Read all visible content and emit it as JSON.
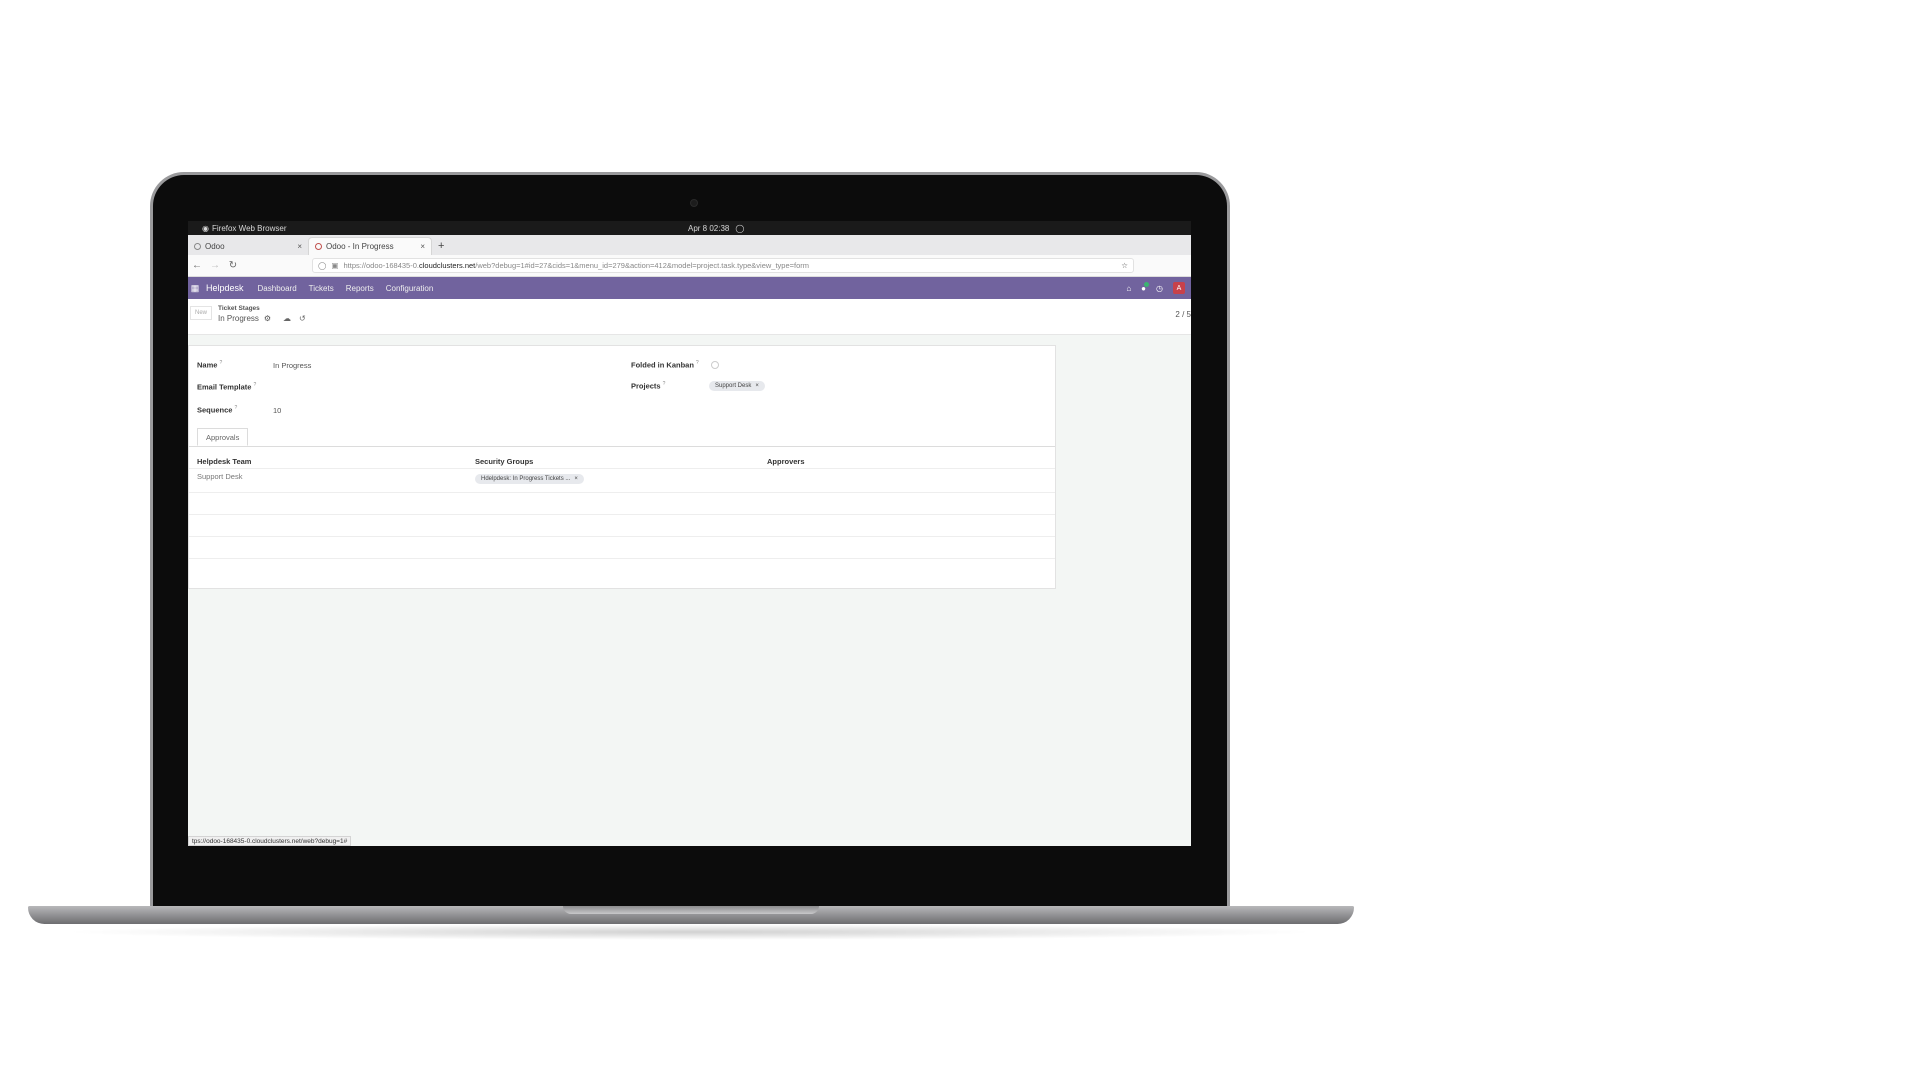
{
  "os_bar": {
    "app_name": "Firefox Web Browser",
    "clock": "Apr 8  02:38"
  },
  "browser": {
    "tabs": [
      {
        "label": "Odoo"
      },
      {
        "label": "Odoo - In Progress"
      }
    ],
    "url": {
      "prefix": "https://odoo-168435-0.",
      "host": "cloudclusters.net",
      "path": "/web?debug=1#id=27&cids=1&menu_id=279&action=412&model=project.task.type&view_type=form"
    },
    "status_url": "tps://odoo-168435-0.cloudclusters.net/web?debug=1#"
  },
  "odoo_nav": {
    "brand": "Helpdesk",
    "menu": [
      "Dashboard",
      "Tickets",
      "Reports",
      "Configuration"
    ],
    "avatar_letter": "A"
  },
  "control_panel": {
    "new_button": "New",
    "breadcrumb_parent": "Ticket Stages",
    "breadcrumb_current": "In Progress",
    "pager": "2 / 5"
  },
  "form": {
    "name_label": "Name",
    "name_value": "In Progress",
    "email_template_label": "Email Template",
    "sequence_label": "Sequence",
    "sequence_value": "10",
    "folded_label": "Folded in Kanban",
    "projects_label": "Projects",
    "projects_tag": "Support Desk",
    "tooltip_mark": "?"
  },
  "notebook": {
    "tab_label": "Approvals",
    "columns": [
      "Helpdesk Team",
      "Security Groups",
      "Approvers"
    ],
    "row": {
      "team": "Support Desk",
      "security_group": "Hdelpdesk: In Progress Tickets ...",
      "approvers": ""
    }
  },
  "colors": {
    "odoo_purple": "#71639e",
    "avatar_red": "#c8414a",
    "chat_green": "#3cb371"
  },
  "icons": [
    "apps-grid-icon",
    "home-icon",
    "chat-icon",
    "clock-icon",
    "gear-icon",
    "cloud-save-icon",
    "undo-icon",
    "lock-icon",
    "shield-icon",
    "star-icon",
    "reload-icon",
    "back-icon",
    "forward-icon",
    "close-icon",
    "bell-icon",
    "firefox-icon"
  ]
}
